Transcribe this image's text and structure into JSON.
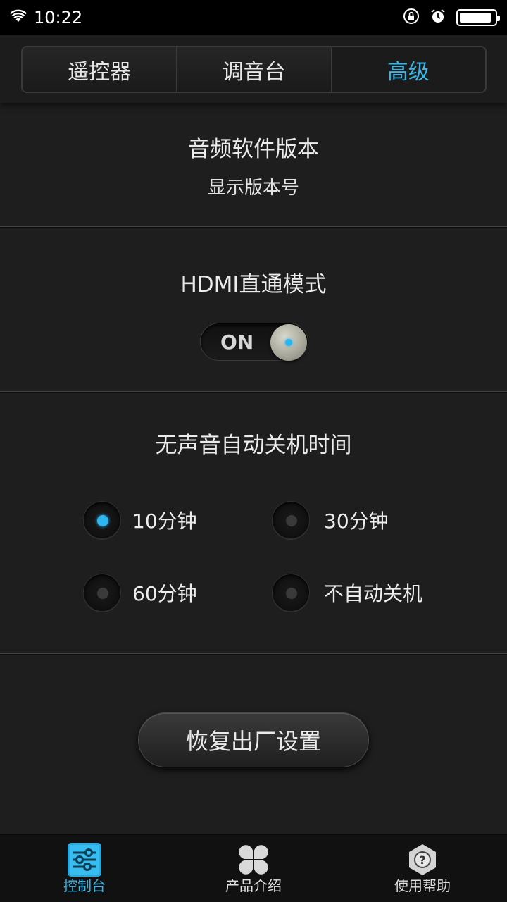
{
  "status_bar": {
    "time": "10:22"
  },
  "tabs": [
    {
      "label": "遥控器",
      "active": false
    },
    {
      "label": "调音台",
      "active": false
    },
    {
      "label": "高级",
      "active": true
    }
  ],
  "audio_version": {
    "title": "音频软件版本",
    "value": "显示版本号"
  },
  "hdmi": {
    "title": "HDMI直通模式",
    "toggle_label": "ON",
    "enabled": true
  },
  "auto_off": {
    "title": "无声音自动关机时间",
    "options": [
      {
        "label": "10分钟",
        "selected": true
      },
      {
        "label": "30分钟",
        "selected": false
      },
      {
        "label": "60分钟",
        "selected": false
      },
      {
        "label": "不自动关机",
        "selected": false
      }
    ]
  },
  "reset_button": {
    "label": "恢复出厂设置"
  },
  "bottom_nav": [
    {
      "label": "控制台",
      "icon": "sliders-icon",
      "active": true
    },
    {
      "label": "产品介绍",
      "icon": "clover-icon",
      "active": false
    },
    {
      "label": "使用帮助",
      "icon": "help-icon",
      "active": false
    }
  ],
  "colors": {
    "accent": "#3ab6e6",
    "background": "#1e1e1e"
  }
}
